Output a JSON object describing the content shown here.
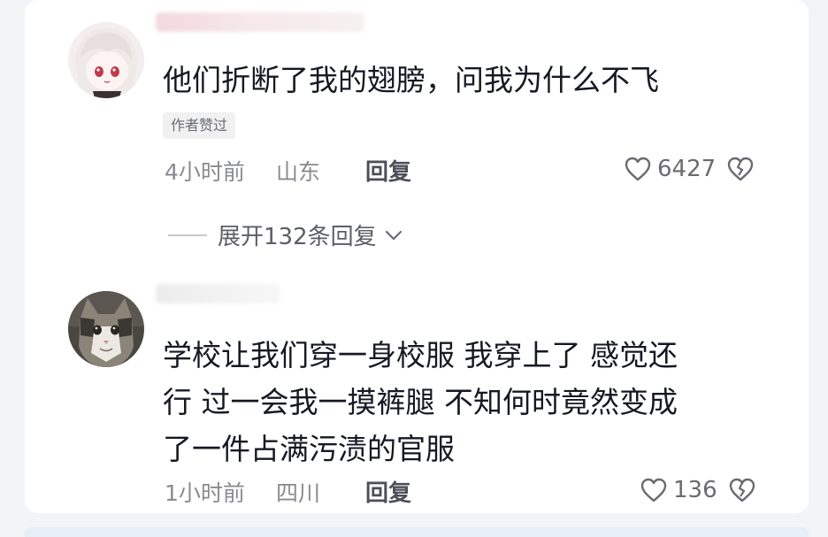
{
  "comments": [
    {
      "avatar": "anime-girl-avatar",
      "text_lines": [
        "他们折断了我的翅膀，问我为什么不飞"
      ],
      "tag": "作者赞过",
      "time": "4小时前",
      "location": "山东",
      "reply_label": "回复",
      "likes": "6427",
      "expand_label": "展开132条回复"
    },
    {
      "avatar": "cat-avatar",
      "text_lines": [
        "学校让我们穿一身校服 我穿上了 感觉还",
        "行 过一会我一摸裤腿 不知何时竟然变成",
        "了一件占满污渍的官服"
      ],
      "time": "1小时前",
      "location": "四川",
      "reply_label": "回复",
      "likes": "136"
    }
  ],
  "icons": {
    "like": "heart-outline-icon",
    "dislike": "broken-heart-icon",
    "expand": "chevron-down-icon"
  },
  "colors": {
    "text": "#161823",
    "meta": "#8a8b91",
    "tag_bg": "#f1f1f2"
  }
}
